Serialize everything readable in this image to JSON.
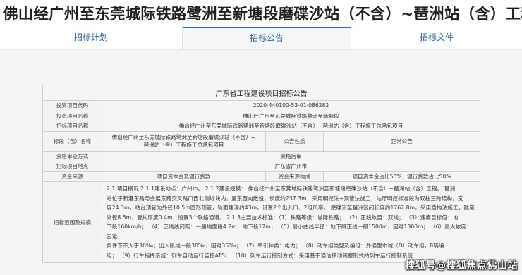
{
  "header": {
    "title": "佛山经广州至东莞城际铁路鹭洲至新塘段磨碟沙站（不含）~琶洲站（含）工程施..."
  },
  "tabs": [
    {
      "label": "招标计划",
      "active": false
    },
    {
      "label": "招标公告",
      "active": true
    },
    {
      "label": "招标文件",
      "active": false
    }
  ],
  "document": {
    "title": "广东省工程建设项目招标公告",
    "rows": {
      "project_code": {
        "label": "投资项目代码",
        "value": "2020-440100-53-01-086282"
      },
      "project_name": {
        "label": "投资项目名称",
        "value": "佛山经广州至东莞城际铁路鹭洲至新塘段"
      },
      "tender_project_name": {
        "label": "招标项目名称",
        "value": "佛山经广州至东莞城际铁路鹭洲至新塘段磨碟沙站（不含）~琶洲站（含）工程施工总承包项目"
      },
      "section": {
        "label": "标段（包）名称",
        "value_line1": "佛山经广州至东莞城际铁路鹭洲至新塘段磨碟沙站（不含）~",
        "value_line2": "琶洲站（含）工程施工总承包项目",
        "nature_label": "公告性质",
        "nature_value": "正常公告"
      },
      "qualification": {
        "label": "资格审查方式",
        "value": "资格后审"
      },
      "location": {
        "label": "招标项目地点",
        "value": "广东省广州市"
      },
      "funding": {
        "label": "资金来源",
        "value": "项目资本金及银行贷款",
        "composition_label": "资金来源构成",
        "composition_value": "项目资本金占比50%，银行贷款占比50%"
      },
      "scope": {
        "label": "招标范围及规模",
        "lines": [
          "2.1 项目概况 2.1.1建设地点：广州市。  2.1.2建设规模： 佛山经广州至东莞城际铁路鹭洲至新塘段磨碟沙站（不含）~琶洲站（含）工程。 琶洲",
          "站位于新港东路与会展东路交叉路口西北侧地块内，呈东西向敷设，长度约237.3m，采用明挖法+顶管法施工，站厅明挖标准段为双柱三跨结构，宽",
          "度24.3m，站台顶管为外径10.5m圆形顶管，轨面埋深约43m，设置2个出入口、2组风亭。 磨碟沙至琶洲区间长度约1762.8m，采用盾构法施工，隧道",
          "外径8.5m，管片厚度0.4m，设置3个联络通道。 2.1.3主要技术标准：（1）铁路等级：城际铁路；  （2）正线数目：双线；  （3）速度目标值：地",
          "下段160km/h；  （4）正线线间距：一般地面段4.2m，地下段17m；  （5）最小曲线半径：地下段正线一般1500m，困难1300m；  （6）最大坡度：困难",
          "条件下不大于30‰；出入段线一般30‰，困难35‰；  （7）牵引种类：电力；  （8）动车组类型及编组：外通型市域（D）动车组，8辆编",
          "组；  （9）行车指挥系统：列车自动运行监控ATS；  （10）列车运行控制方式：采用基于通信移动闭塞制式的列车运行控制系统"
        ]
      }
    }
  },
  "watermark": "搜狐号@搜狐焦点佛山站"
}
